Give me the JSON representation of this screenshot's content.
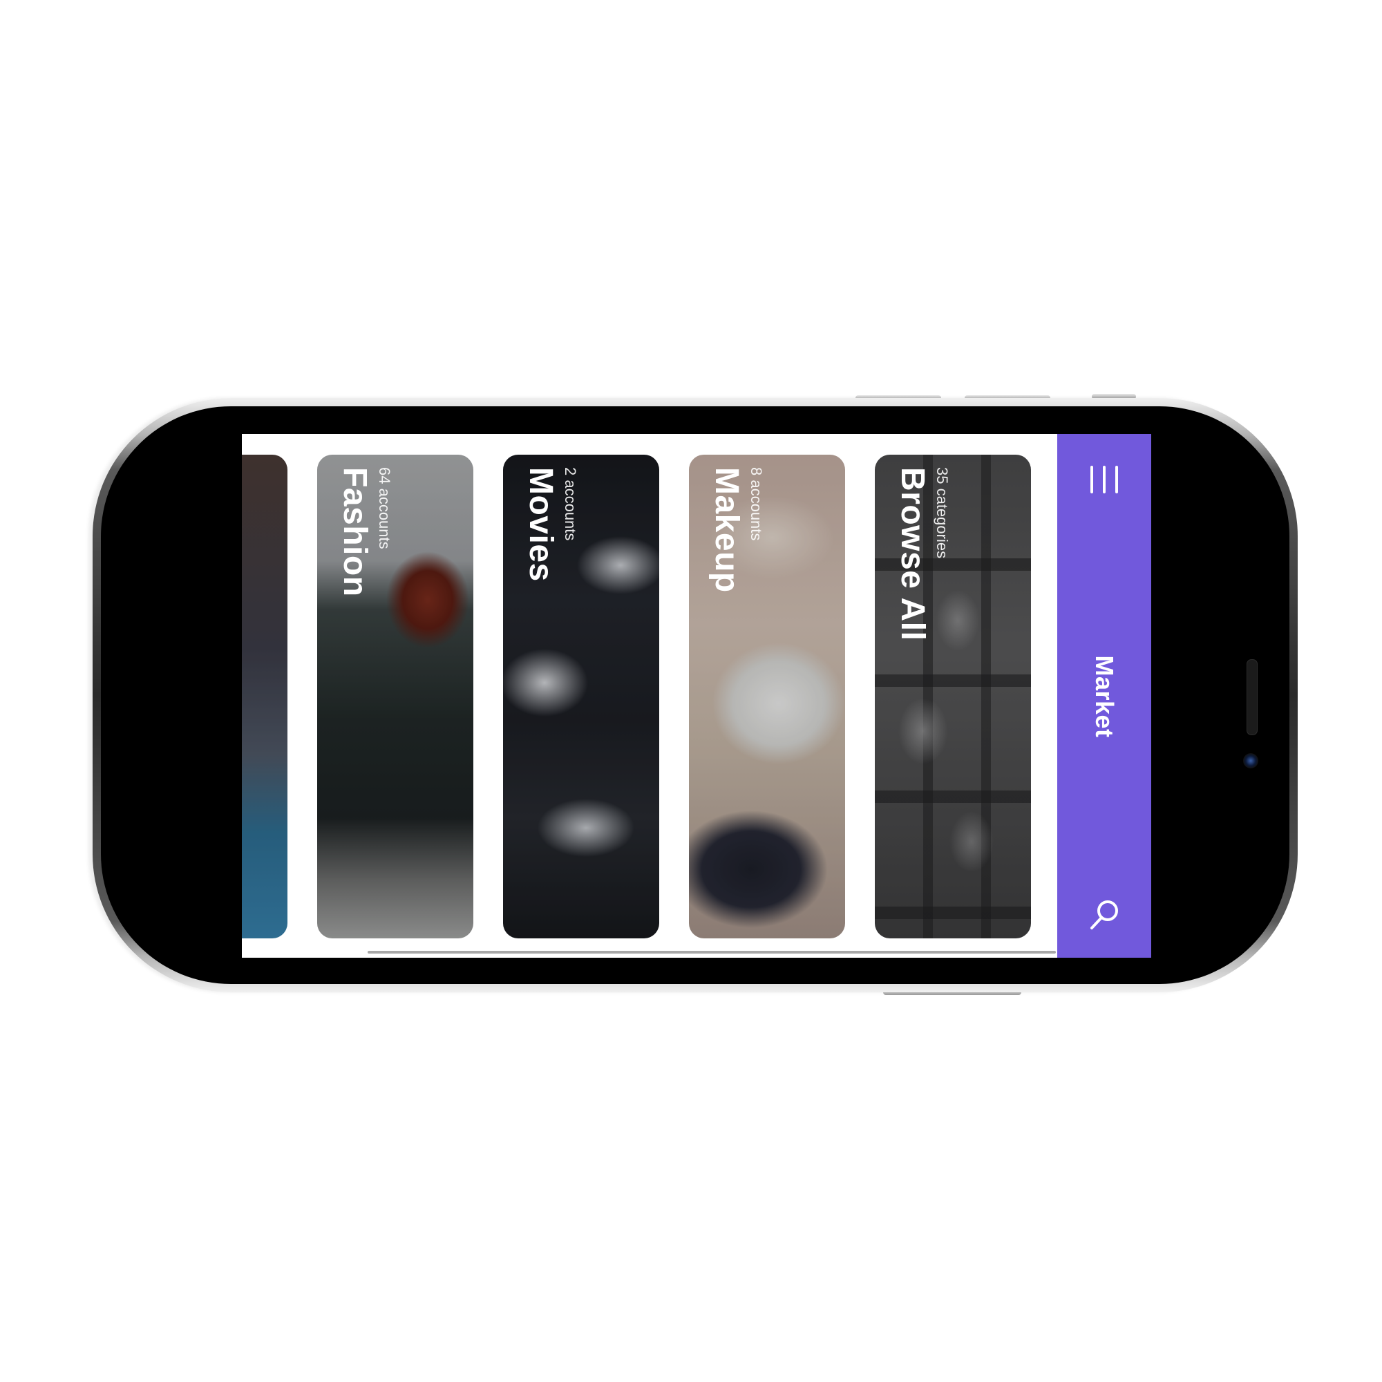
{
  "app": {
    "title": "Market"
  },
  "categories": [
    {
      "id": "partial",
      "count_label": "",
      "title": ""
    },
    {
      "id": "fashion",
      "count_label": "64 accounts",
      "title": "Fashion"
    },
    {
      "id": "movies",
      "count_label": "2 accounts",
      "title": "Movies"
    },
    {
      "id": "makeup",
      "count_label": "8 accounts",
      "title": "Makeup"
    },
    {
      "id": "browse",
      "count_label": "35 categories",
      "title": "Browse All"
    }
  ],
  "icons": {
    "menu": "menu-icon",
    "search": "search-icon"
  },
  "colors": {
    "accent": "#7159dc",
    "screen_background": "#ffffff",
    "scroll_indicator": "#a7a7a7"
  }
}
